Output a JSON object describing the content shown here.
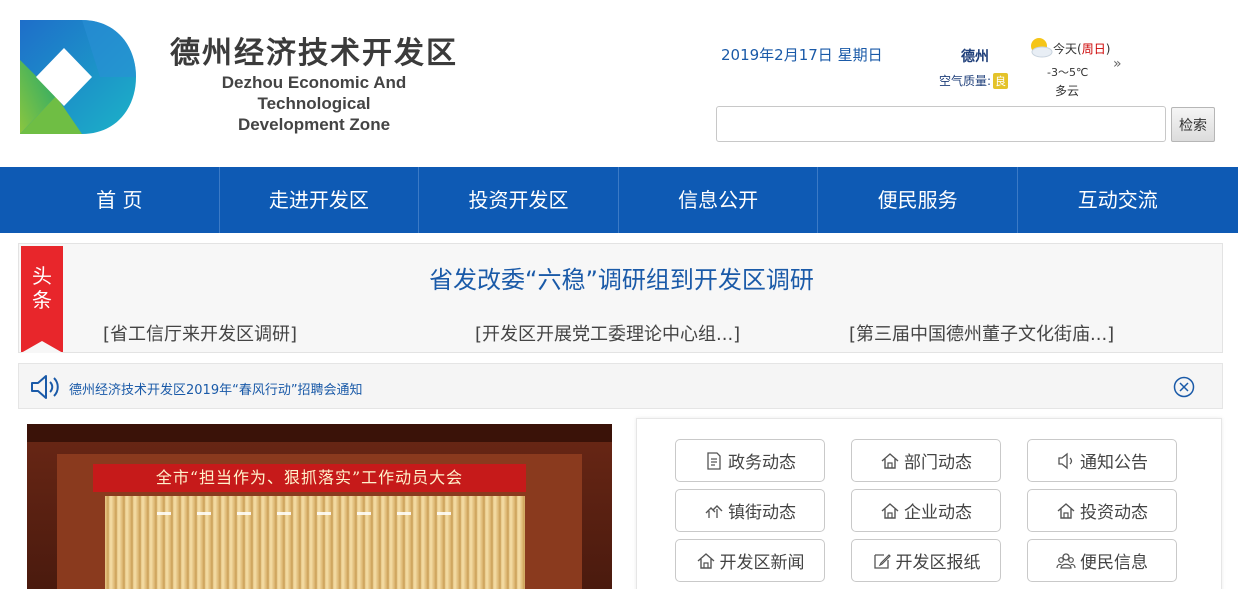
{
  "brand": {
    "name_cn": "德州经济技术开发区",
    "name_en_line1": "Dezhou Economic And Technological",
    "name_en_line2": "Development Zone"
  },
  "date": "2019年2月17日 星期日",
  "weather": {
    "city": "德州",
    "air_quality_label": "空气质量:",
    "air_quality_value": "良",
    "today_label": "今天",
    "dow": "周日",
    "temp": "-3～5℃",
    "desc": "多云",
    "more": "»"
  },
  "search": {
    "value": "",
    "button": "检索"
  },
  "nav": [
    "首  页",
    "走进开发区",
    "投资开发区",
    "信息公开",
    "便民服务",
    "互动交流"
  ],
  "headline": {
    "ribbon": [
      "头",
      "条"
    ],
    "title": "省发改委“六稳”调研组到开发区调研",
    "links": [
      "[省工信厅来开发区调研]",
      "[开发区开展党工委理论中心组...]",
      "[第三届中国德州董子文化街庙...]"
    ]
  },
  "notice": {
    "text": "德州经济技术开发区2019年“春风行动”招聘会通知"
  },
  "photo": {
    "banner": "全市“担当作为、狠抓落实”工作动员大会"
  },
  "categories": [
    "政务动态",
    "部门动态",
    "通知公告",
    "镇街动态",
    "企业动态",
    "投资动态",
    "开发区新闻",
    "开发区报纸",
    "便民信息"
  ],
  "colors": {
    "nav": "#0e5ab4",
    "accent_red": "#e8262b",
    "link_blue": "#1a5aa8"
  }
}
